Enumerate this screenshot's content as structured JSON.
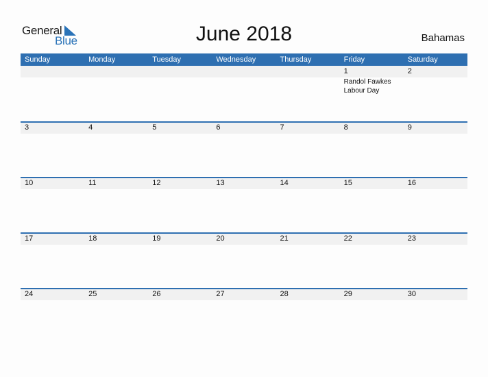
{
  "logo": {
    "line1": "General",
    "line2": "Blue",
    "accent_color": "#2a73b8"
  },
  "title": "June 2018",
  "country": "Bahamas",
  "colors": {
    "header_bg": "#2e6fb1",
    "date_strip_bg": "#f1f1f1"
  },
  "weekdays": [
    "Sunday",
    "Monday",
    "Tuesday",
    "Wednesday",
    "Thursday",
    "Friday",
    "Saturday"
  ],
  "weeks": [
    [
      {
        "day": ""
      },
      {
        "day": ""
      },
      {
        "day": ""
      },
      {
        "day": ""
      },
      {
        "day": ""
      },
      {
        "day": "1",
        "event": "Randol Fawkes Labour Day"
      },
      {
        "day": "2"
      }
    ],
    [
      {
        "day": "3"
      },
      {
        "day": "4"
      },
      {
        "day": "5"
      },
      {
        "day": "6"
      },
      {
        "day": "7"
      },
      {
        "day": "8"
      },
      {
        "day": "9"
      }
    ],
    [
      {
        "day": "10"
      },
      {
        "day": "11"
      },
      {
        "day": "12"
      },
      {
        "day": "13"
      },
      {
        "day": "14"
      },
      {
        "day": "15"
      },
      {
        "day": "16"
      }
    ],
    [
      {
        "day": "17"
      },
      {
        "day": "18"
      },
      {
        "day": "19"
      },
      {
        "day": "20"
      },
      {
        "day": "21"
      },
      {
        "day": "22"
      },
      {
        "day": "23"
      }
    ],
    [
      {
        "day": "24"
      },
      {
        "day": "25"
      },
      {
        "day": "26"
      },
      {
        "day": "27"
      },
      {
        "day": "28"
      },
      {
        "day": "29"
      },
      {
        "day": "30"
      }
    ]
  ]
}
